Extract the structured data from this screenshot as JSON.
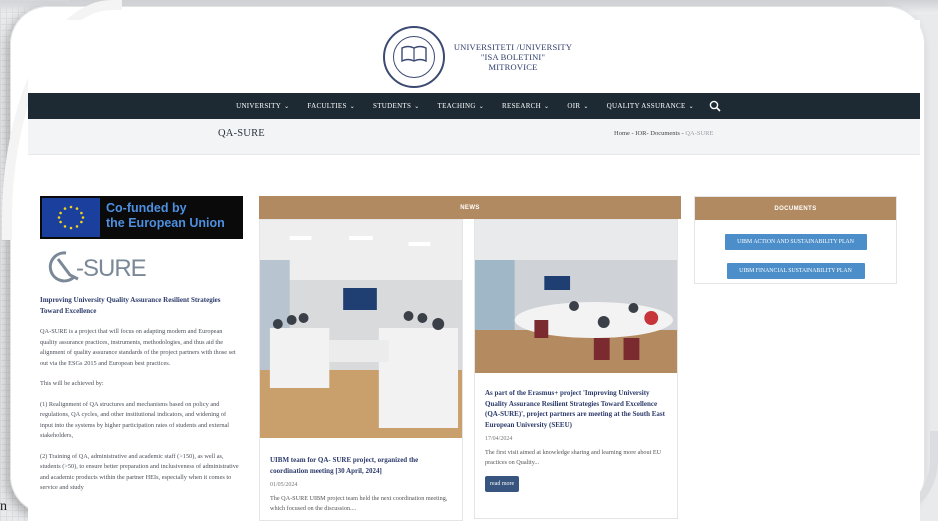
{
  "header": {
    "uni_line1": "UNIVERSITETI /UNIVERSITY",
    "uni_line2": "\"ISA BOLETINI\"",
    "uni_line3": "MITROVICE"
  },
  "nav": {
    "items": [
      {
        "label": "UNIVERSITY"
      },
      {
        "label": "FACULTIES"
      },
      {
        "label": "STUDENTS"
      },
      {
        "label": "TEACHING"
      },
      {
        "label": "RESEARCH"
      },
      {
        "label": "OIR"
      },
      {
        "label": "QUALITY ASSURANCE"
      }
    ],
    "caret": "⌄",
    "search_icon": "search-icon"
  },
  "title_bar": {
    "title": "QA-SURE",
    "breadcrumb_trail": "Home - IOR- Documents - ",
    "breadcrumb_current": "QA-SURE"
  },
  "left": {
    "eu_line1": "Co-funded by",
    "eu_line2": "the European Union",
    "qa_logo_text": "-SURE",
    "heading": "Improving University Quality Assurance Resilient Strategies Toward Excellence",
    "p1": "QA-SURE is a project that will focus on adapting modern and European quality assurance practices, instruments, methodologies, and thus aid the alignment of quality assurance standards of the project partners with those set out via the ESGs 2015 and European best practices.",
    "p2": "This will be achieved by:",
    "p3": "(1) Realignment of QA structures and mechanisms based on policy and regulations, QA cycles, and other institutional indicators, and widening of input into the systems by higher participation rates of students and external stakeholders,",
    "p4": "(2) Training of QA, administrative and academic staff (>150), as well as, students (>50), to ensure better preparation and inclusiveness of administrative and academic products within the partner HEIs, especially when it comes to service and study"
  },
  "news": {
    "header": "NEWS",
    "cards": [
      {
        "title": "UIBM team for QA- SURE project, organized the coordination meeting [30 April, 2024]",
        "date": "01/05/2024",
        "excerpt": "The QA-SURE UIBM project team held the next coordination meeting, which focused on the discussion...."
      },
      {
        "title": "As part of the Erasmus+ project 'Improving University Quality Assurance Resilient Strategies Toward Excellence (QA-SURE)', project partners are meeting at the South East European University (SEEU)",
        "date": "17/04/2024",
        "excerpt": "The first visit aimed at knowledge sharing and learning more about EU practices on Quality...",
        "read_more": "read more"
      }
    ]
  },
  "documents": {
    "header": "DOCUMENTS",
    "buttons": [
      {
        "label": "UIBM ACTION AND SUSTAINABILITY PLAN"
      },
      {
        "label": "UIBM FINANCIAL SUSTAINABILITY PLAN"
      }
    ]
  },
  "corner_letter": "n",
  "colors": {
    "navbar": "#1d2a33",
    "accent_tan": "#b28a62",
    "doc_button": "#4b8ec9",
    "read_more": "#38557f",
    "heading_blue": "#2c3a6a"
  }
}
